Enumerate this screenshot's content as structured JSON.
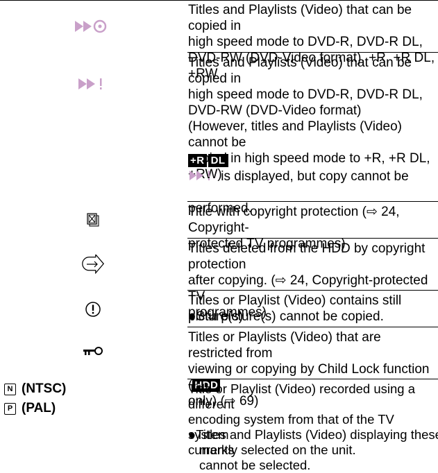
{
  "rows": [
    {
      "icon": "high-speed-copy-disc-icon",
      "text": "Titles and Playlists (Video) that can be copied in\nhigh speed mode to DVD-R, DVD-R DL,\nDVD-RW (DVD-Video format), +R, +R DL, +RW"
    },
    {
      "icon": "high-speed-copy-restricted-icon",
      "text": "Titles and Playlists (Video) that can be copied in\nhigh speed mode to DVD-R, DVD-R DL,\nDVD-RW (DVD-Video format)\n(However, titles and Playlists (Video) cannot be\ncopied in high speed mode to +R, +R DL, +RW)",
      "note_badge1": "+R",
      "note_badge2": "DL",
      "note_text_a": " is displayed, but copy cannot be",
      "note_text_b": "performed."
    },
    {
      "icon": "copyright-protection-icon",
      "text": "Title with copyright protection (⇨ 24, Copyright-\nprotected TV programmes)"
    },
    {
      "icon": "deleted-after-copy-arrow-icon",
      "text": "Titles deleted from the HDD by copyright protection\nafter copying. (⇨ 24, Copyright-protected TV\nprogrammes)"
    },
    {
      "icon": "still-picture-warning-icon",
      "text": "Titles or Playlist (Video) contains still picture(s)",
      "bullet": "Still picture(s) cannot be copied."
    },
    {
      "icon": "child-lock-key-icon",
      "text_a": "Titles or Playlists (Video) that are restricted from\nviewing or copying by Child Lock function (",
      "badge": "HDD",
      "text_b": "\nonly) (⇨ 69)"
    },
    {
      "label_ntsc": "(NTSC)",
      "label_pal": "(PAL)",
      "mark_n": "N",
      "mark_p": "P",
      "text": "Title or Playlist (Video) recorded using a different\nencoding system from that of the TV system\ncurrently selected on the unit.",
      "bullet": "Titles and Playlists (Video) displaying these marks\ncannot be selected."
    }
  ],
  "bullet_char": "●"
}
